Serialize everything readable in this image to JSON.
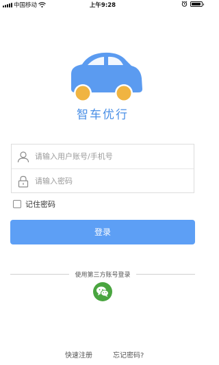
{
  "status_bar": {
    "carrier": "中国移动",
    "time": "上午9:28"
  },
  "app": {
    "name": "智车优行",
    "logo_icon": "car-icon",
    "colors": {
      "car_body": "#5b9bf0",
      "wheels": "#f0b441",
      "brand_text": "#4a8fe6"
    }
  },
  "form": {
    "account_placeholder": "请输入用户账号/手机号",
    "password_placeholder": "请输入密码",
    "account_icon": "user-icon",
    "password_icon": "lock-icon",
    "remember_label": "记住密码",
    "remember_checked": false
  },
  "login_button": {
    "label": "登录",
    "color": "#5d9ff5"
  },
  "third_party": {
    "label": "使用第三方账号登录",
    "wechat_icon": "wechat-icon",
    "color": "#4aa540"
  },
  "links": {
    "register": "快速注册",
    "forgot": "忘记密码?"
  }
}
